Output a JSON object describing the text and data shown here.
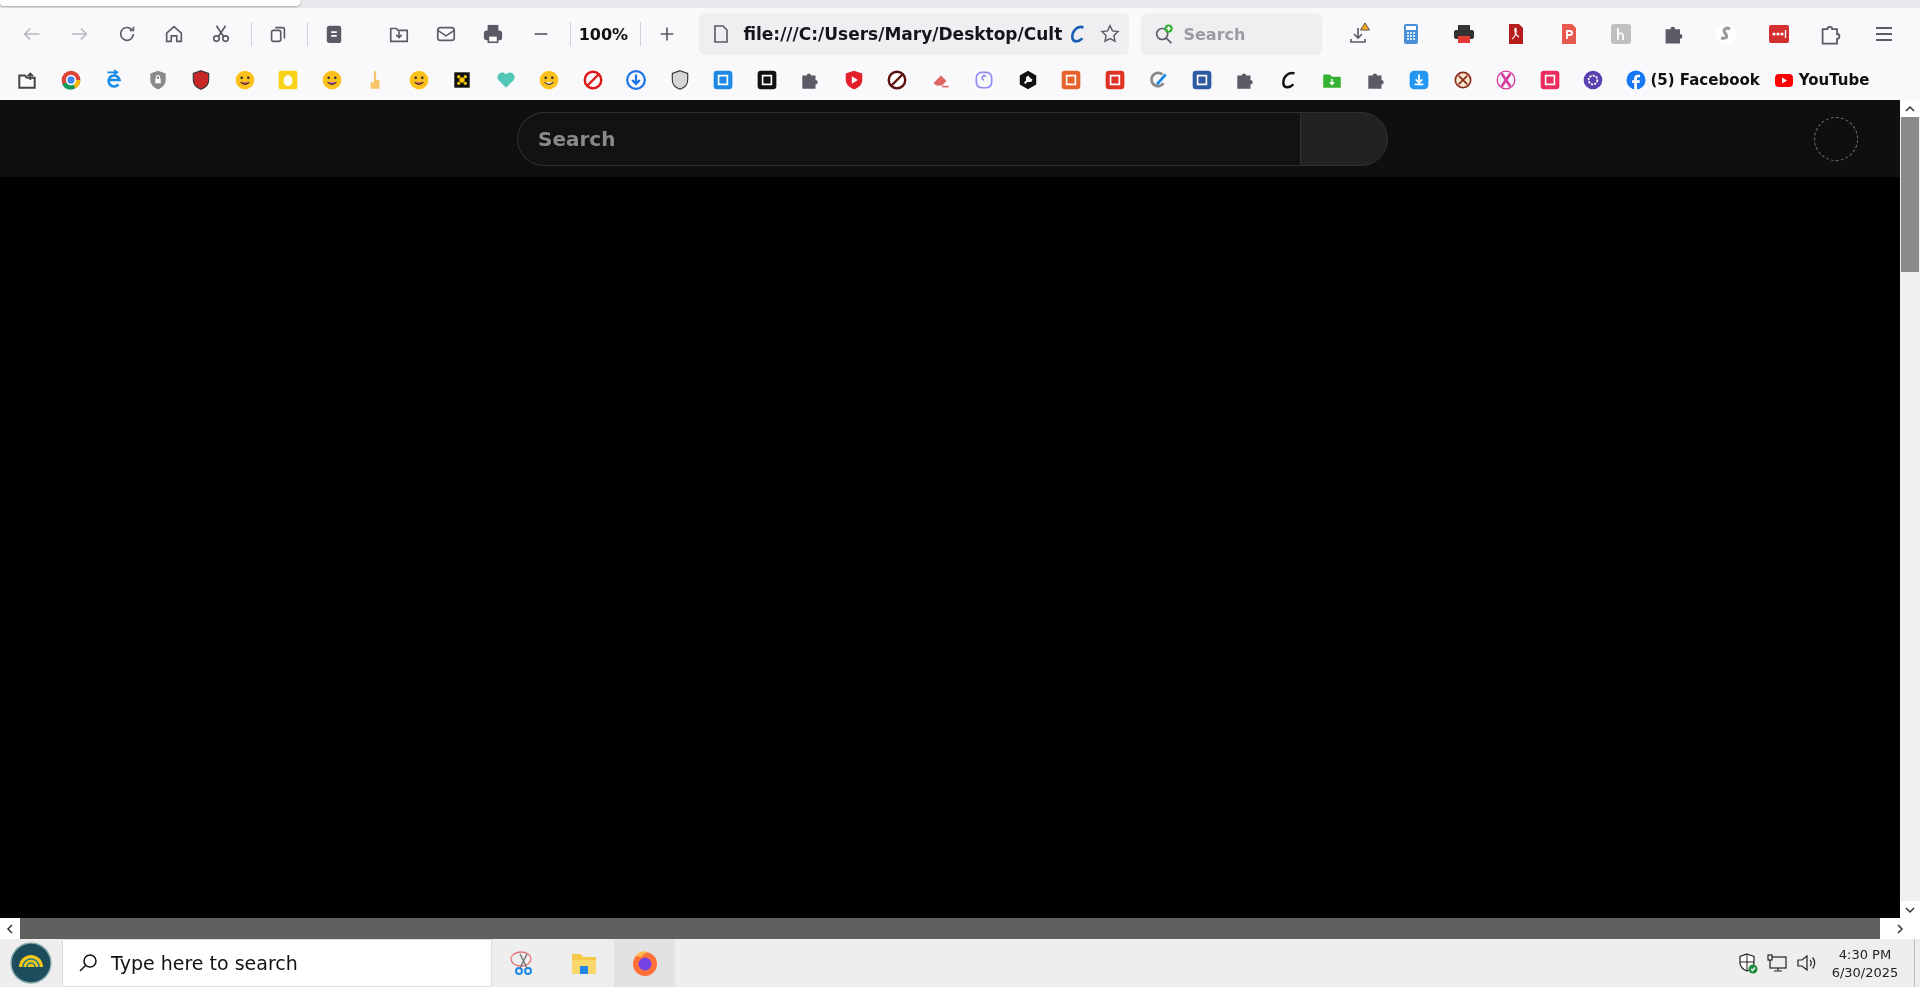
{
  "browser": {
    "toolbar": {
      "back_disabled": true,
      "forward_disabled": true,
      "zoom": "100%",
      "url": "file:///C:/Users/Mary/Desktop/Cult",
      "search_placeholder": "Search"
    },
    "bookmarks": [
      {
        "label": "(5) Facebook"
      },
      {
        "label": "YouTube"
      }
    ]
  },
  "page": {
    "search_placeholder": "Search"
  },
  "taskbar": {
    "search_placeholder": "Type here to search",
    "time": "4:30 PM",
    "date": "6/30/2025"
  }
}
